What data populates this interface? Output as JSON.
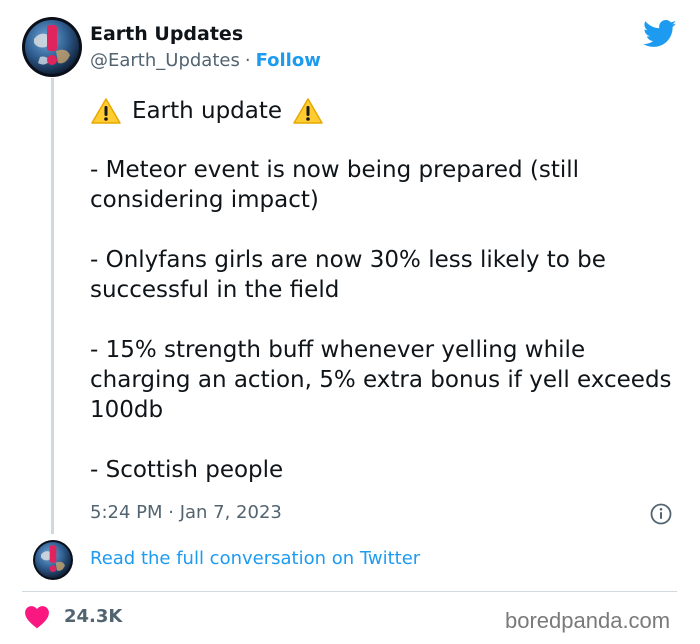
{
  "author": {
    "name": "Earth Updates",
    "handle": "@Earth_Updates",
    "separator": "·",
    "follow_label": "Follow"
  },
  "tweet": {
    "headline": "Earth update",
    "paragraphs": [
      "- Meteor event is now being prepared (still considering impact)",
      "- Onlyfans girls are now 30% less likely to be successful in the field",
      "- 15% strength buff whenever yelling while charging an action, 5% extra bonus if yell exceeds 100db",
      "- Scottish people"
    ],
    "timestamp": "5:24 PM · Jan 7, 2023"
  },
  "conversation_link": "Read the full conversation on Twitter",
  "engagement": {
    "likes": "24.3K"
  },
  "watermark": "boredpanda.com",
  "colors": {
    "twitter_blue": "#1d9bf0",
    "secondary_text": "#536471",
    "heart_red": "#f91880",
    "warning_yellow": "#ffcc32"
  },
  "icons": [
    "twitter-bird-icon",
    "warning-icon",
    "info-icon",
    "heart-icon"
  ]
}
